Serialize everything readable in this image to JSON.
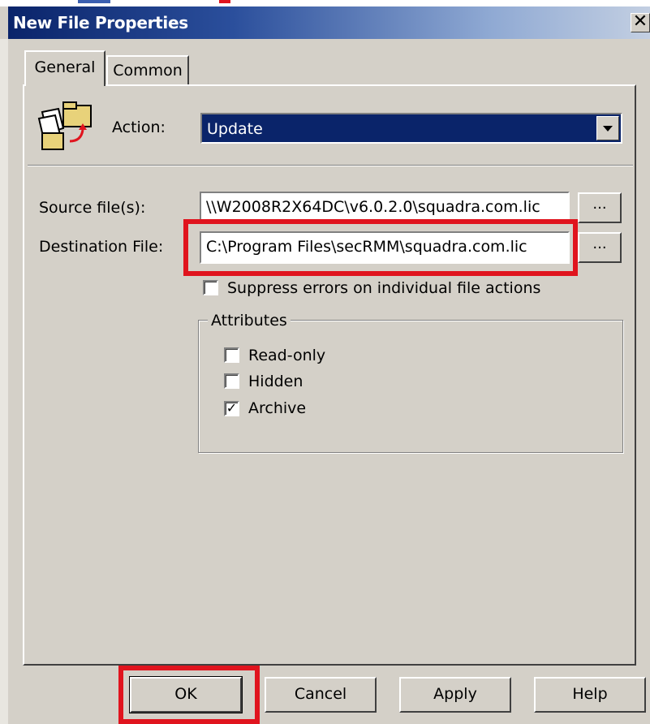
{
  "window": {
    "title": "New File Properties",
    "close_glyph": "✕"
  },
  "tabs": [
    {
      "label": "General",
      "selected": true
    },
    {
      "label": "Common",
      "selected": false
    }
  ],
  "icon": {
    "name": "file-copy-icon"
  },
  "action": {
    "label": "Action:",
    "value": "Update"
  },
  "source": {
    "label": "Source file(s):",
    "value": "\\\\W2008R2X64DC\\v6.0.2.0\\squadra.com.lic",
    "browse_label": "..."
  },
  "destination": {
    "label": "Destination File:",
    "value": "C:\\Program Files\\secRMM\\squadra.com.lic",
    "browse_label": "..."
  },
  "suppress_errors": {
    "label": "Suppress errors on individual file actions",
    "checked": false
  },
  "attributes": {
    "legend": "Attributes",
    "items": [
      {
        "label": "Read-only",
        "checked": false
      },
      {
        "label": "Hidden",
        "checked": false
      },
      {
        "label": "Archive",
        "checked": true
      }
    ]
  },
  "buttons": {
    "ok": "OK",
    "cancel": "Cancel",
    "apply": "Apply",
    "help": "Help"
  },
  "check_glyph": "✓",
  "colors": {
    "title_bar": "#0a246a",
    "selection": "#0a246a",
    "highlight": "#e0141e",
    "face": "#d4d0c8"
  }
}
